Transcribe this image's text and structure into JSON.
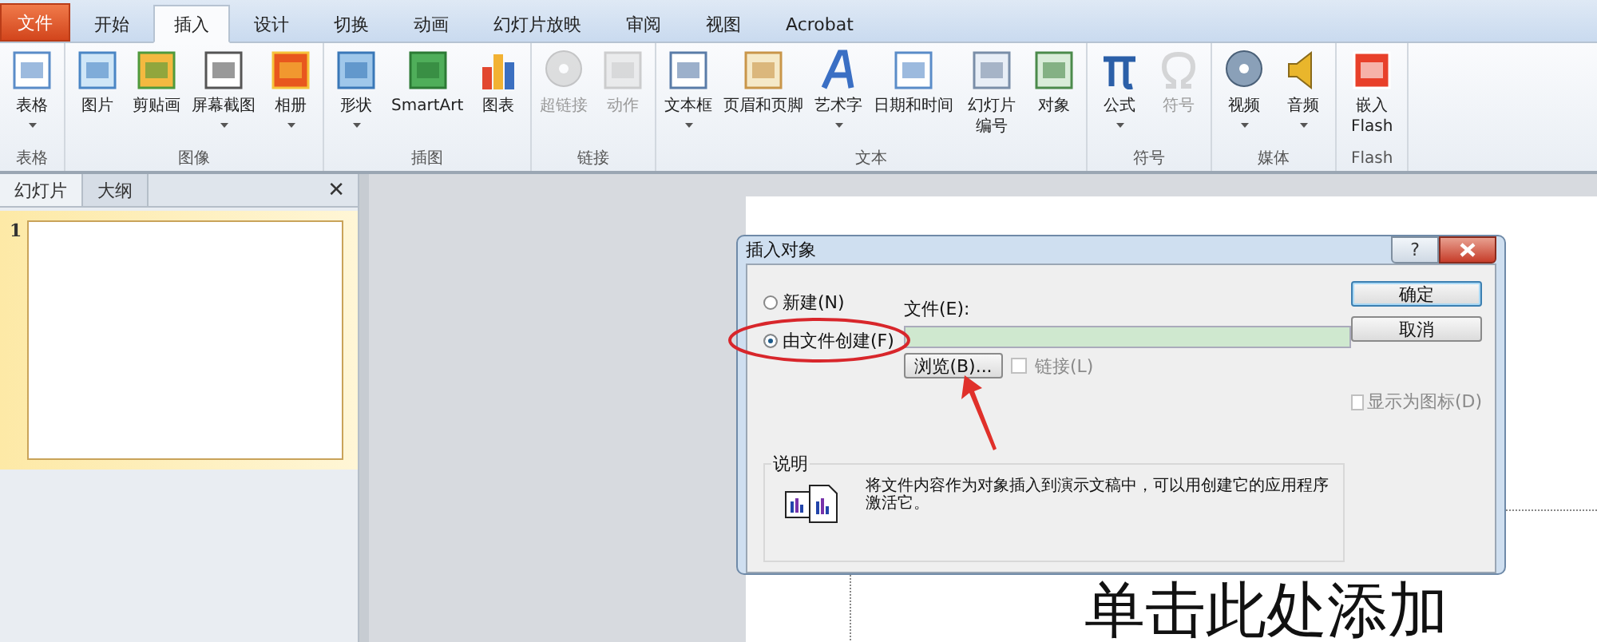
{
  "tabs": [
    {
      "label": "文件",
      "kind": "file",
      "selected": false
    },
    {
      "label": "开始",
      "kind": "tab",
      "selected": false
    },
    {
      "label": "插入",
      "kind": "tab",
      "selected": true
    },
    {
      "label": "设计",
      "kind": "tab",
      "selected": false
    },
    {
      "label": "切换",
      "kind": "tab",
      "selected": false
    },
    {
      "label": "动画",
      "kind": "tab",
      "selected": false
    },
    {
      "label": "幻灯片放映",
      "kind": "tab",
      "selected": false
    },
    {
      "label": "审阅",
      "kind": "tab",
      "selected": false
    },
    {
      "label": "视图",
      "kind": "tab",
      "selected": false
    },
    {
      "label": "Acrobat",
      "kind": "tab",
      "selected": false
    }
  ],
  "ribbon_groups": [
    {
      "label": "表格",
      "buttons": [
        {
          "label": "表格",
          "dropdown": true,
          "disabled": false
        }
      ]
    },
    {
      "label": "图像",
      "buttons": [
        {
          "label": "图片",
          "dropdown": false,
          "disabled": false
        },
        {
          "label": "剪贴画",
          "dropdown": false,
          "disabled": false
        },
        {
          "label": "屏幕截图",
          "dropdown": true,
          "disabled": false
        },
        {
          "label": "相册",
          "dropdown": true,
          "disabled": false
        }
      ]
    },
    {
      "label": "插图",
      "buttons": [
        {
          "label": "形状",
          "dropdown": true,
          "disabled": false
        },
        {
          "label": "SmartArt",
          "dropdown": false,
          "disabled": false
        },
        {
          "label": "图表",
          "dropdown": false,
          "disabled": false
        }
      ]
    },
    {
      "label": "链接",
      "buttons": [
        {
          "label": "超链接",
          "dropdown": false,
          "disabled": true
        },
        {
          "label": "动作",
          "dropdown": false,
          "disabled": true
        }
      ]
    },
    {
      "label": "文本",
      "buttons": [
        {
          "label": "文本框",
          "dropdown": true,
          "disabled": false
        },
        {
          "label": "页眉和页脚",
          "dropdown": false,
          "disabled": false
        },
        {
          "label": "艺术字",
          "dropdown": true,
          "disabled": false
        },
        {
          "label": "日期和时间",
          "dropdown": false,
          "disabled": false
        },
        {
          "label": "幻灯片编号",
          "narrow": true,
          "dropdown": false,
          "disabled": false
        },
        {
          "label": "对象",
          "dropdown": false,
          "disabled": false
        }
      ]
    },
    {
      "label": "符号",
      "buttons": [
        {
          "label": "公式",
          "dropdown": true,
          "disabled": false
        },
        {
          "label": "符号",
          "dropdown": false,
          "disabled": true
        }
      ]
    },
    {
      "label": "媒体",
      "buttons": [
        {
          "label": "视频",
          "dropdown": true,
          "disabled": false
        },
        {
          "label": "音频",
          "dropdown": true,
          "disabled": false
        }
      ]
    },
    {
      "label": "Flash",
      "buttons": [
        {
          "label": "嵌入 Flash",
          "narrow": true,
          "dropdown": false,
          "disabled": false
        }
      ]
    }
  ],
  "pane": {
    "tabs": [
      {
        "label": "幻灯片",
        "selected": true
      },
      {
        "label": "大纲",
        "selected": false
      }
    ],
    "close": "✕",
    "slides": [
      {
        "number": "1",
        "selected": true
      }
    ]
  },
  "slide": {
    "title_placeholder": "单击此处添加"
  },
  "dialog": {
    "title": "插入对象",
    "help": "?",
    "options": [
      {
        "label": "新建(N)",
        "selected": false
      },
      {
        "label": "由文件创建(F)",
        "selected": true
      }
    ],
    "file_label": "文件(E):",
    "browse": "浏览(B)...",
    "link": {
      "label": "链接(L)",
      "checked": false,
      "disabled": true
    },
    "ok": "确定",
    "cancel": "取消",
    "show_as_icon": {
      "label": "显示为图标(D)",
      "checked": false,
      "disabled": true
    },
    "description_title": "说明",
    "description": "将文件内容作为对象插入到演示文稿中，可以用创建它的应用程序激活它。"
  }
}
